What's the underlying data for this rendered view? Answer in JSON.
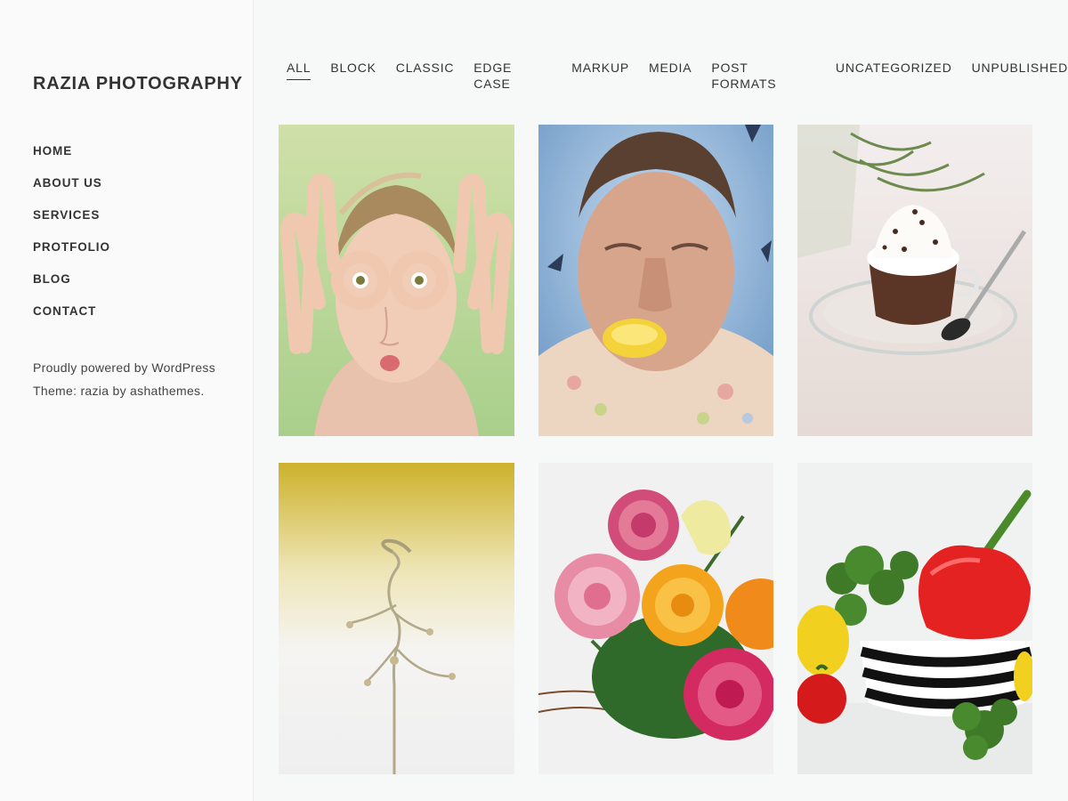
{
  "site": {
    "title": "RAZIA PHOTOGRAPHY"
  },
  "main_nav": [
    {
      "label": "HOME"
    },
    {
      "label": "ABOUT US"
    },
    {
      "label": "SERVICES"
    },
    {
      "label": "PROTFOLIO"
    },
    {
      "label": "BLOG"
    },
    {
      "label": "CONTACT"
    }
  ],
  "footer": {
    "powered_by": "Proudly powered by WordPress",
    "theme_credit": "Theme: razia by ashathemes."
  },
  "filters": [
    {
      "label": "ALL",
      "active": true
    },
    {
      "label": "BLOCK"
    },
    {
      "label": "CLASSIC"
    },
    {
      "label": "EDGE CASE"
    },
    {
      "label": "MARKUP"
    },
    {
      "label": "MEDIA"
    },
    {
      "label": "POST FORMATS"
    },
    {
      "label": "UNCATEGORIZED"
    },
    {
      "label": "UNPUBLISHED"
    }
  ],
  "gallery": [
    {
      "icon": "woman-finger-goggles-photo"
    },
    {
      "icon": "man-lemon-mouth-photo"
    },
    {
      "icon": "hot-chocolate-cup-photo"
    },
    {
      "icon": "water-splash-sculpture-photo"
    },
    {
      "icon": "flower-bouquet-photo"
    },
    {
      "icon": "vegetables-bowl-photo"
    }
  ],
  "colors": {
    "text": "#333333",
    "sidebar_bg": "#fafafa",
    "page_bg": "#f7f8f8"
  }
}
